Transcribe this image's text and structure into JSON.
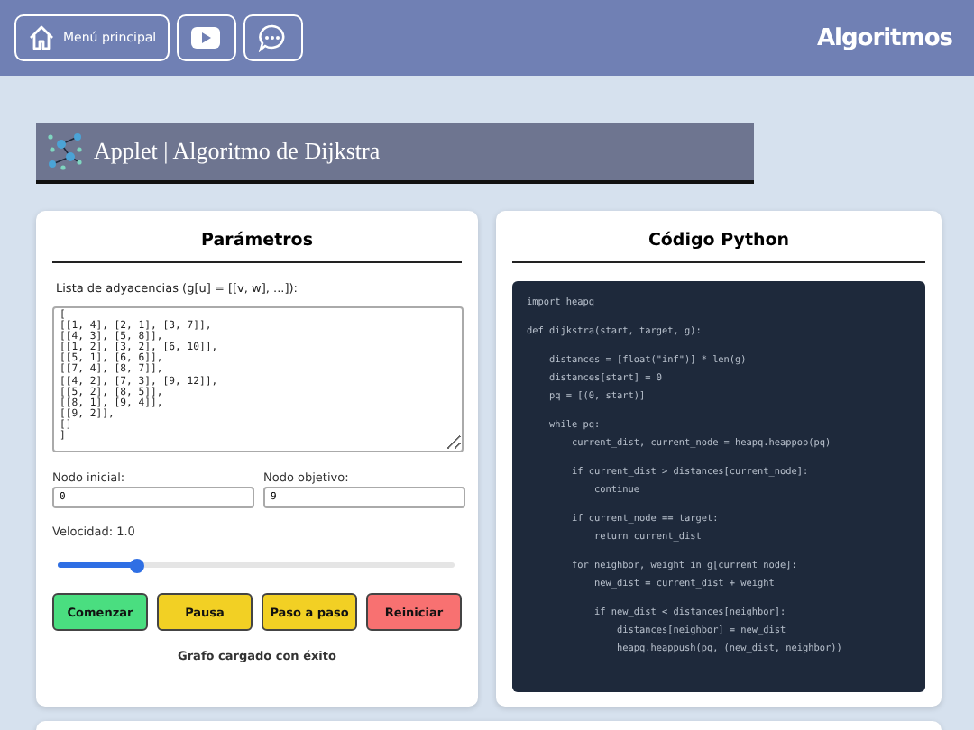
{
  "header": {
    "menu_button": "Menú principal",
    "logo": "Algoritmos"
  },
  "title_bar": {
    "title": "Applet | Algoritmo de Dijkstra"
  },
  "parameters": {
    "title": "Parámetros",
    "adjacency_label": "Lista de adyacencias (g[u] = [[v, w], ...]):",
    "adjacency_value": "[\n[[1, 4], [2, 1], [3, 7]],\n[[4, 3], [5, 8]],\n[[1, 2], [3, 2], [6, 10]],\n[[5, 1], [6, 6]],\n[[7, 4], [8, 7]],\n[[4, 2], [7, 3], [9, 12]],\n[[5, 2], [8, 5]],\n[[8, 1], [9, 4]],\n[[9, 2]],\n[]\n]",
    "start_label": "Nodo inicial:",
    "start_value": "0",
    "target_label": "Nodo objetivo:",
    "target_value": "9",
    "speed_label": "Velocidad: 1.0",
    "speed": {
      "level": 0.2
    },
    "buttons": [
      {
        "label": "Comenzar",
        "kind": "start"
      },
      {
        "label": "Pausa",
        "kind": "pause"
      },
      {
        "label": "Paso a paso",
        "kind": "step"
      },
      {
        "label": "Reiniciar",
        "kind": "reset"
      }
    ],
    "status": "Grafo cargado con éxito"
  },
  "code": {
    "title": "Código Python",
    "blocks": [
      [
        "import heapq"
      ],
      [
        "def dijkstra(start, target, g):"
      ],
      [
        "    distances = [float(\"inf\")] * len(g)",
        "    distances[start] = 0",
        "    pq = [(0, start)]"
      ],
      [
        "    while pq:",
        "        current_dist, current_node = heapq.heappop(pq)"
      ],
      [
        "        if current_dist > distances[current_node]:",
        "            continue"
      ],
      [
        "        if current_node == target:",
        "            return current_dist"
      ],
      [
        "        for neighbor, weight in g[current_node]:",
        "            new_dist = current_dist + weight"
      ],
      [
        "            if new_dist < distances[neighbor]:",
        "                distances[neighbor] = new_dist",
        "                heapq.heappush(pq, (new_dist, neighbor))"
      ]
    ]
  }
}
